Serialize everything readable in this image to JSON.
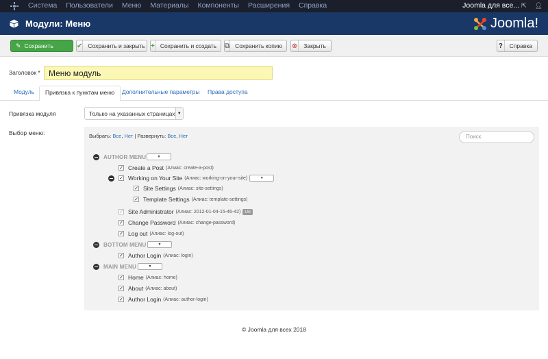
{
  "topbar": {
    "menu": [
      "Система",
      "Пользователи",
      "Меню",
      "Материалы",
      "Компоненты",
      "Расширения",
      "Справка"
    ],
    "site_name": "Joomla для все...",
    "external_icon": "external-link-icon",
    "user_icon": "user-icon"
  },
  "header": {
    "title": "Модули: Меню",
    "brand": "Joomla!"
  },
  "toolbar": {
    "save": "Сохранить",
    "save_close": "Сохранить и закрыть",
    "save_new": "Сохранить и создать",
    "save_copy": "Сохранить копию",
    "close": "Закрыть",
    "help": "Справка"
  },
  "form": {
    "title_label": "Заголовок",
    "title_required": " *",
    "title_value": "Меню модуль"
  },
  "tabs": [
    "Модуль",
    "Привязка к пунктам меню",
    "Дополнительные параметры",
    "Права доступа"
  ],
  "assignment": {
    "label": "Привязка модуля",
    "value": "Только на указанных страницах"
  },
  "menu_select": {
    "label": "Выбор меню:",
    "select_prefix": "Выбрать:",
    "select_all": "Все",
    "select_none": "Нет",
    "separator": "|",
    "expand_prefix": "Развернуть:",
    "expand_all": "Все",
    "expand_none": "Нет",
    "search_placeholder": "Поиск"
  },
  "tree": {
    "author_menu": "AUTHOR MENU",
    "bottom_menu": "BOTTOM MENU",
    "main_menu": "MAIN MENU",
    "items": [
      {
        "label": "Create a Post",
        "alias": "(Алиас: create-a-post)"
      },
      {
        "label": "Working on Your Site",
        "alias": "(Алиас: working-on-your-site)"
      },
      {
        "label": "Site Settings",
        "alias": "(Алиас: site-settings)"
      },
      {
        "label": "Template Settings",
        "alias": "(Алиас: template-settings)"
      },
      {
        "label": "Site Administrator",
        "alias": "(Алиас: 2012-01-04-15-46-42)",
        "badge": "Url"
      },
      {
        "label": "Change Password",
        "alias": "(Алиас: change-password)"
      },
      {
        "label": "Log out",
        "alias": "(Алиас: log-out)"
      },
      {
        "label": "Author Login",
        "alias": "(Алиас: login)"
      },
      {
        "label": "Home",
        "alias": "(Алиас: home)"
      },
      {
        "label": "About",
        "alias": "(Алиас: about)"
      },
      {
        "label": "Author Login",
        "alias": "(Алиас: author-login)"
      }
    ]
  },
  "footer": "© Joomla для всех 2018"
}
